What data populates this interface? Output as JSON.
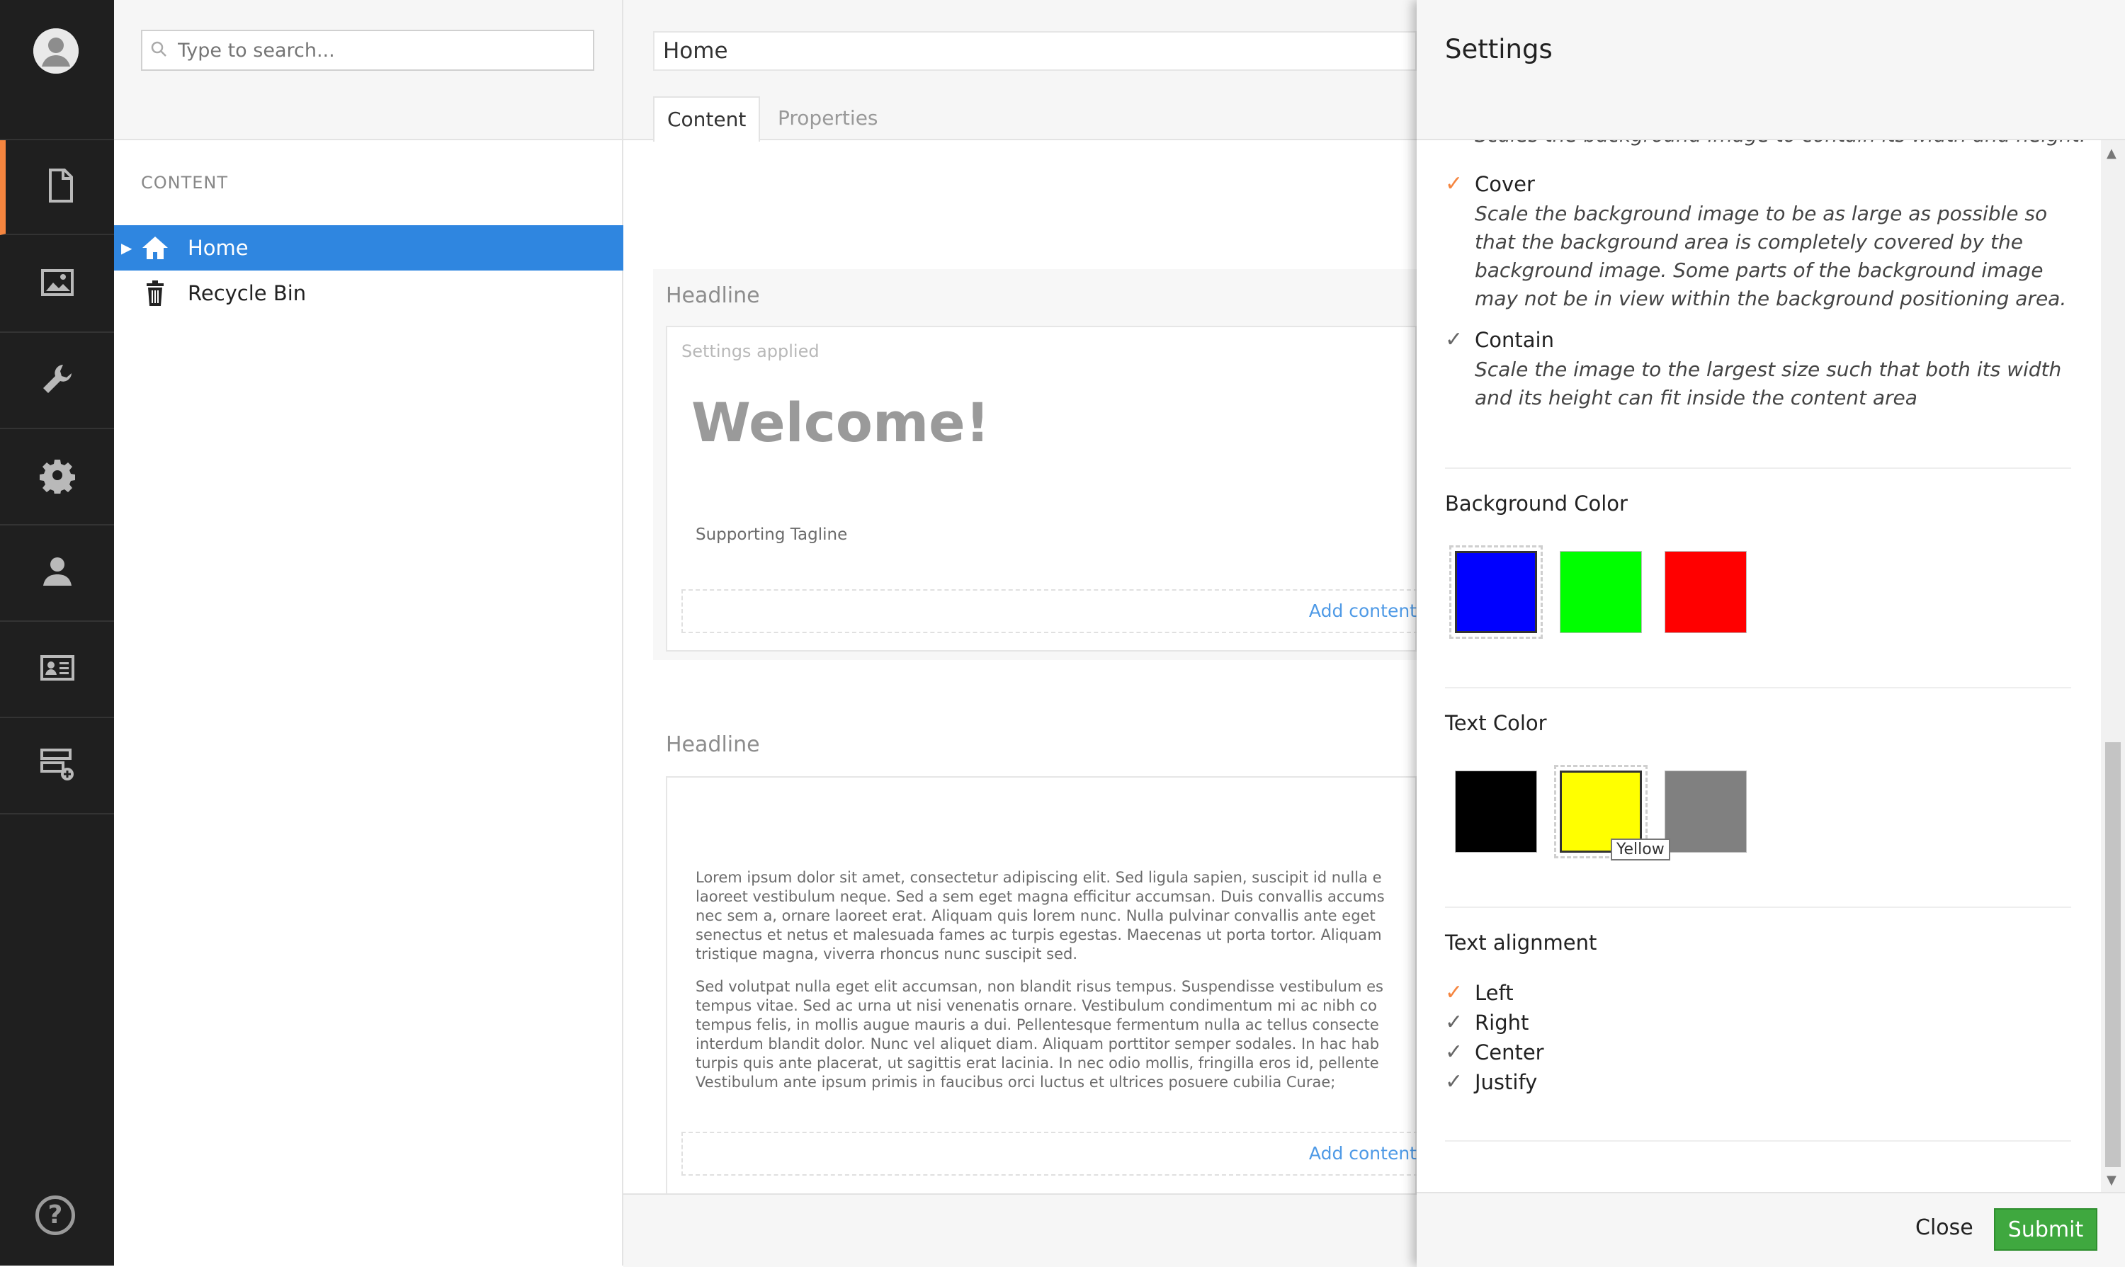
{
  "search": {
    "placeholder": "Type to search..."
  },
  "tree": {
    "section_label": "CONTENT",
    "nodes": [
      {
        "label": "Home",
        "icon": "home-icon",
        "selected": true
      },
      {
        "label": "Recycle Bin",
        "icon": "trash-icon",
        "selected": false
      }
    ]
  },
  "editor": {
    "name": "Home",
    "tabs": [
      "Content",
      "Properties"
    ],
    "blocks": [
      {
        "headline": "Headline",
        "settings_note": "Settings applied",
        "title": "Welcome!",
        "tagline": "Supporting Tagline",
        "add_content": "Add content"
      },
      {
        "headline": "Headline",
        "paragraph1": "Lorem ipsum dolor sit amet, consectetur adipiscing elit. Sed ligula sapien, suscipit id nulla e\nlaoreet vestibulum neque. Sed a sem eget magna efficitur accumsan. Duis convallis accums\nnec sem a, ornare laoreet erat. Aliquam quis lorem nunc. Nulla pulvinar convallis ante eget\nsenectus et netus et malesuada fames ac turpis egestas. Maecenas ut porta tortor. Aliquam\ntristique magna, viverra rhoncus nunc suscipit sed.",
        "paragraph2": "Sed volutpat nulla eget elit accumsan, non blandit risus tempus. Suspendisse vestibulum es\ntempus vitae. Sed ac urna ut nisi venenatis ornare. Vestibulum condimentum mi ac nibh co\ntempus felis, in mollis augue mauris a dui. Pellentesque fermentum nulla ac tellus consecte\ninterdum blandit dolor. Nunc vel aliquet diam. Aliquam porttitor semper sodales. In hac hab\nturpis quis ante placerat, ut sagittis erat lacinia. In nec odio mollis, fringilla eros id, pellente\nVestibulum ante ipsum primis in faucibus orci luctus et ultrices posuere cubilia Curae;",
        "add_content": "Add content"
      }
    ]
  },
  "settings": {
    "title": "Settings",
    "size_partial_text": "Scales the background image to contain its width and height.",
    "size_options": [
      {
        "title": "Cover",
        "checked": true,
        "description": "Scale the background image to be as large as possible so that the background area is completely covered by the background image. Some parts of the background image may not be in view within the background positioning area."
      },
      {
        "title": "Contain",
        "checked": false,
        "description": "Scale the image to the largest size such that both its width and its height can fit inside the content area"
      }
    ],
    "background_color": {
      "label": "Background Color",
      "swatches": [
        {
          "name": "Blue",
          "hex": "#0000ff",
          "selected": true
        },
        {
          "name": "Green",
          "hex": "#00ff00",
          "selected": false
        },
        {
          "name": "Red",
          "hex": "#ff0000",
          "selected": false
        }
      ]
    },
    "text_color": {
      "label": "Text Color",
      "swatches": [
        {
          "name": "Black",
          "hex": "#000000",
          "selected": false
        },
        {
          "name": "Yellow",
          "hex": "#ffff00",
          "selected": true
        },
        {
          "name": "Gray",
          "hex": "#808080",
          "selected": false
        }
      ],
      "tooltip": "Yellow"
    },
    "text_alignment": {
      "label": "Text alignment",
      "options": [
        {
          "label": "Left",
          "checked": true
        },
        {
          "label": "Right",
          "checked": false
        },
        {
          "label": "Center",
          "checked": false
        },
        {
          "label": "Justify",
          "checked": false
        }
      ]
    },
    "footer": {
      "close_label": "Close",
      "submit_label": "Submit"
    }
  },
  "colors": {
    "accent_orange": "#f5853f",
    "selection_blue": "#2f86e0",
    "submit_green": "#3fa83f",
    "link_blue": "#4f9ae6",
    "rail_bg": "#1f1f1f"
  },
  "rail_icons": [
    "document-icon",
    "image-icon",
    "wrench-icon",
    "gear-icon",
    "user-icon",
    "contact-card-icon",
    "form-add-icon",
    "help-icon"
  ]
}
